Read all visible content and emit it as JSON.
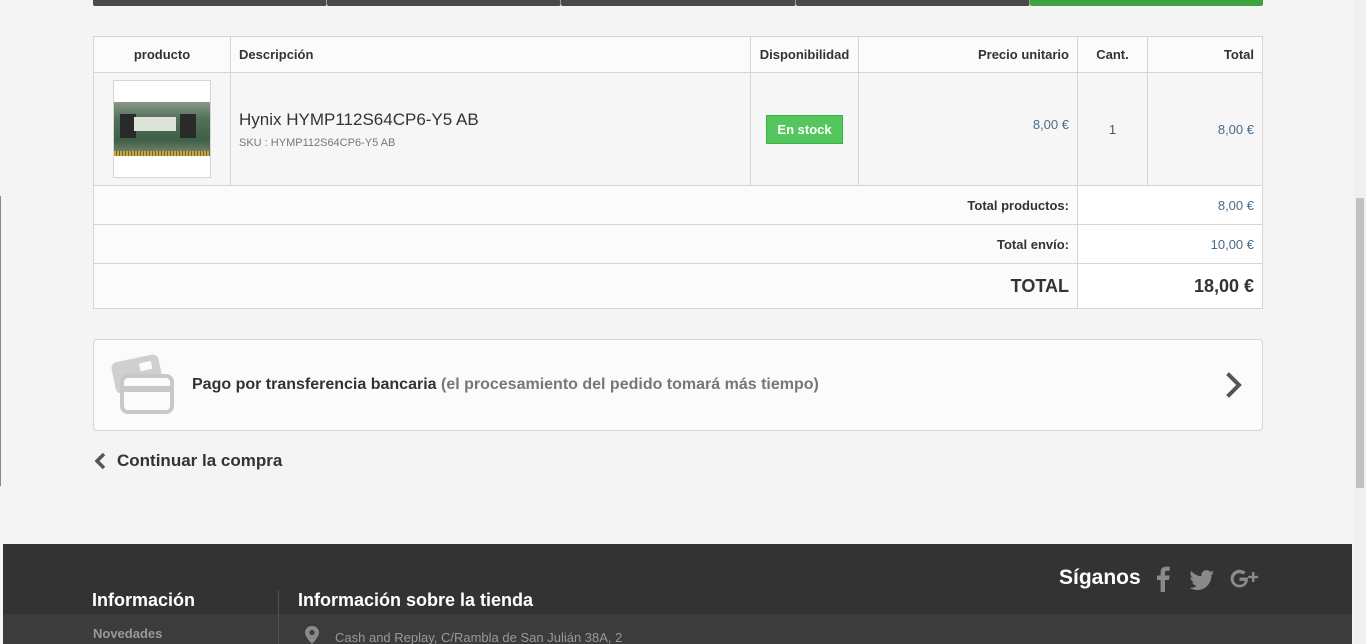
{
  "cart_table": {
    "headers": {
      "product": "producto",
      "description": "Descripción",
      "availability": "Disponibilidad",
      "unit_price": "Precio unitario",
      "quantity": "Cant.",
      "total": "Total"
    },
    "item": {
      "name": "Hynix HYMP112S64CP6-Y5 AB",
      "sku": "SKU : HYMP112S64CP6-Y5 AB",
      "availability": "En stock",
      "unit_price": "8,00 €",
      "quantity": "1",
      "total": "8,00 €"
    },
    "summary": {
      "products_label": "Total productos:",
      "products_value": "8,00 €",
      "shipping_label": "Total envío:",
      "shipping_value": "10,00 €",
      "grand_label": "TOTAL",
      "grand_value": "18,00 €"
    }
  },
  "payment": {
    "label": "Pago por transferencia bancaria",
    "note": "(el procesamiento del pedido tomará más tiempo)"
  },
  "continue_label": "Continuar la compra",
  "footer": {
    "follow_label": "Síganos",
    "info_title": "Información",
    "store_title": "Información sobre la tienda",
    "link_new": "Novedades",
    "address": "Cash and Replay, C/Rambla de San Julián 38A, 2"
  },
  "colors": {
    "accent_green": "#3da240",
    "stock_badge": "#55c65e",
    "price_blue": "#4a6b8a",
    "footer_bg": "#333333"
  },
  "icons": {
    "payment": "bank-card-icon",
    "chevron_right": "chevron-right-icon",
    "chevron_left": "chevron-left-icon",
    "facebook": "facebook-icon",
    "twitter": "twitter-icon",
    "google_plus": "google-plus-icon",
    "location": "map-pin-icon"
  }
}
